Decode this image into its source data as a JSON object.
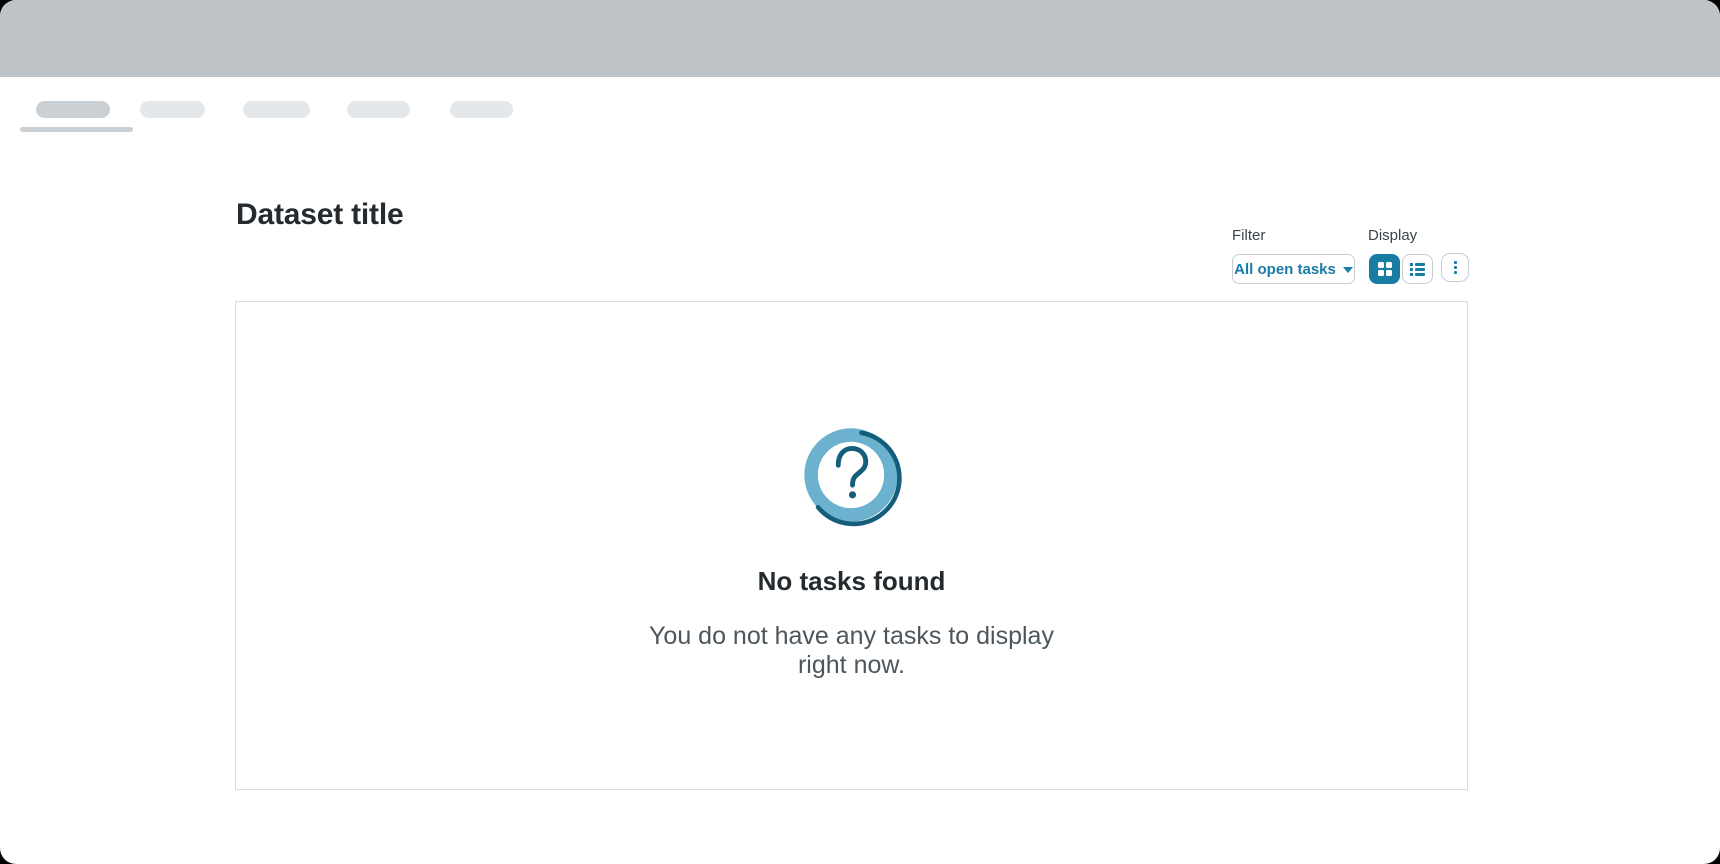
{
  "colors": {
    "accent": "#187CA3",
    "accent_dark": "#155E7B",
    "icon_ring": "#6CB2CE",
    "banner": "#BDC3C7",
    "pill_active": "#CBD0D4",
    "pill_inactive": "#E5E8EA",
    "border": "#C7CDD1",
    "card_border": "#D9DDE0",
    "heading": "#242A2E",
    "text": "#4C565C"
  },
  "tabs": {
    "items": [
      {
        "active": true
      },
      {
        "active": false
      },
      {
        "active": false
      },
      {
        "active": false
      },
      {
        "active": false
      }
    ]
  },
  "header": {
    "title": "Dataset title"
  },
  "toolbar": {
    "filter_label": "Filter",
    "filter_value": "All open tasks",
    "display_label": "Display",
    "icons": {
      "filter_caret": "caret-down-icon",
      "grid": "grid-view-icon",
      "list": "list-view-icon",
      "more": "kebab-menu-icon"
    },
    "display_selected": "grid"
  },
  "empty_state": {
    "icon": "question-circle-icon",
    "title": "No tasks found",
    "description_line1": "You do not have any tasks to display",
    "description_line2": "right now."
  }
}
